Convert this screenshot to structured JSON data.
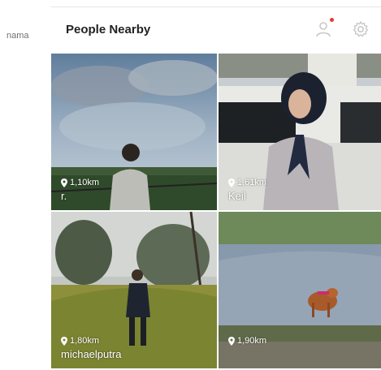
{
  "side_label": "nama",
  "header": {
    "title": "People Nearby",
    "person_icon": "person-icon",
    "gear_icon": "gear-icon",
    "notification_color": "#e53935"
  },
  "people": [
    {
      "distance": "1,10km",
      "name": "r."
    },
    {
      "distance": "1,61km",
      "name": "Keil"
    },
    {
      "distance": "1,80km",
      "name": "michaelputra"
    },
    {
      "distance": "1,90km",
      "name": ""
    }
  ],
  "colors": {
    "icon_gray": "#c8c8c8",
    "text_white": "#ffffff"
  }
}
